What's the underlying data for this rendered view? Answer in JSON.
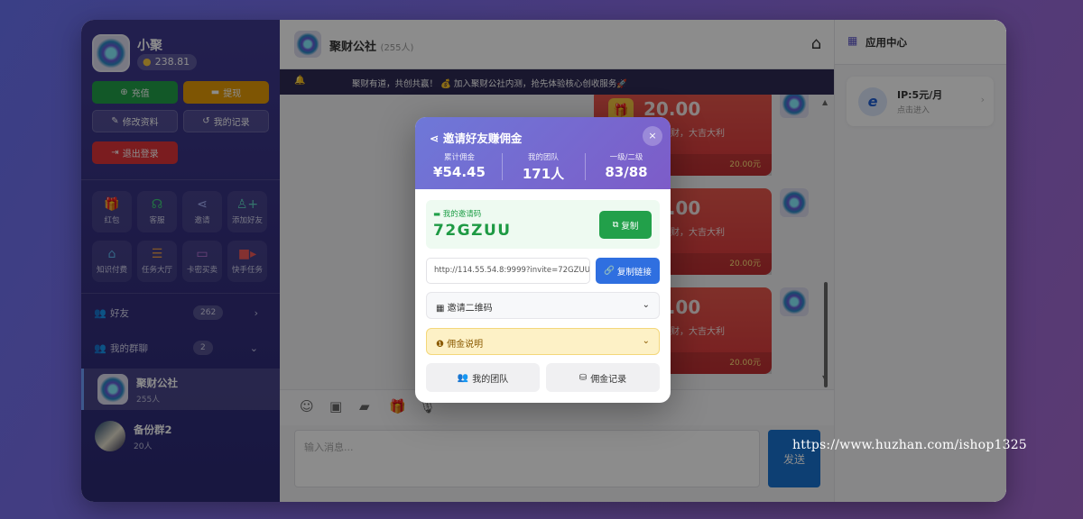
{
  "sidebar": {
    "username": "小聚",
    "balance": "238.81",
    "buttons": {
      "recharge": "充值",
      "withdraw": "提现",
      "edit_profile": "修改资料",
      "my_records": "我的记录",
      "logout": "退出登录"
    },
    "grid": [
      {
        "label": "红包",
        "icon": "gift-icon"
      },
      {
        "label": "客服",
        "icon": "headset-icon"
      },
      {
        "label": "邀请",
        "icon": "share-icon"
      },
      {
        "label": "添加好友",
        "icon": "add-user-icon"
      },
      {
        "label": "知识付费",
        "icon": "store-icon"
      },
      {
        "label": "任务大厅",
        "icon": "task-list-icon"
      },
      {
        "label": "卡密买卖",
        "icon": "card-icon"
      },
      {
        "label": "快手任务",
        "icon": "video-icon"
      }
    ],
    "friends": {
      "label": "好友",
      "count": "262"
    },
    "my_groups": {
      "label": "我的群聊",
      "count": "2"
    },
    "groups": [
      {
        "name": "聚财公社",
        "members": "255人"
      },
      {
        "name": "备份群2",
        "members": "20人"
      }
    ]
  },
  "chat": {
    "title": "聚财公社",
    "member_count": "(255人)",
    "announcement": "聚财有道，共创共赢！ 💰 加入聚财公社内测，抢先体验核心创收服务🚀",
    "red_packets": [
      {
        "amount": "20.00",
        "text": "恭喜发财，大吉大利",
        "footer": "20.00元"
      },
      {
        "amount": "20.00",
        "text": "恭喜发财，大吉大利",
        "footer": "20.00元"
      },
      {
        "amount": "20.00",
        "text": "恭喜发财，大吉大利",
        "footer": "20.00元"
      }
    ],
    "input_placeholder": "输入消息...",
    "send_label": "发送"
  },
  "right_panel": {
    "title": "应用中心",
    "app_card": {
      "title": "IP:5元/月",
      "subtitle": "点击进入"
    }
  },
  "modal": {
    "title": "邀请好友赚佣金",
    "close_label": "×",
    "stats": [
      {
        "label": "累计佣金",
        "value": "¥54.45"
      },
      {
        "label": "我的团队",
        "value": "171人"
      },
      {
        "label": "一级/二级",
        "value": "83/88"
      }
    ],
    "code_label": "我的邀请码",
    "invite_code": "72GZUU",
    "copy_label": "复制",
    "invite_link": "http://114.55.54.8:9999?invite=72GZUU",
    "copy_link_label": "复制链接",
    "qr_label": "邀请二维码",
    "info_label": "佣金说明",
    "team_button": "我的团队",
    "records_button": "佣金记录"
  },
  "watermark": "https://www.huzhan.com/ishop1325",
  "colors": {
    "sidebar_bg": "#35307f",
    "accent_green": "#22a04a",
    "accent_blue": "#2f6fe0",
    "red_packet": "#d9363a",
    "modal_header": "#7d5cc8"
  }
}
